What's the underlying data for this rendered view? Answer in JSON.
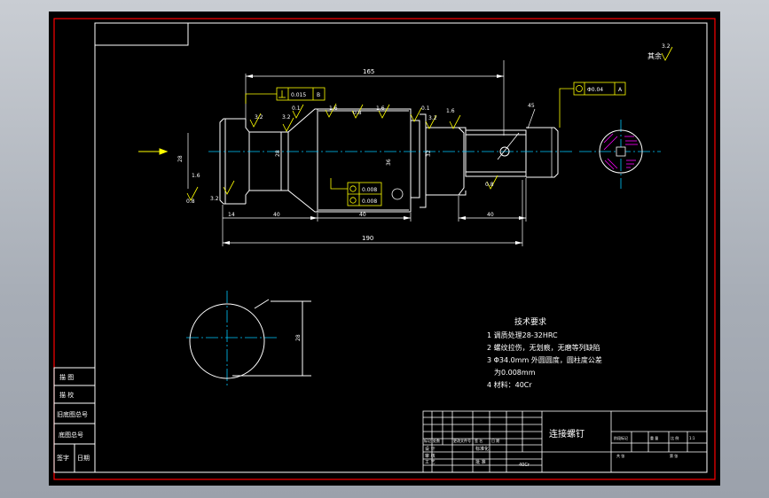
{
  "drawing": {
    "part_name": "连接螺钉",
    "dimensions": {
      "top_overall": "165",
      "bottom_overall": "190",
      "left_len": "14",
      "mid_len": "40",
      "section_len": "40",
      "right_len": "40",
      "left_dia": "28",
      "d1": "28",
      "d2": "36",
      "small_dia": "32",
      "sec_dia": "28"
    },
    "roughness": {
      "r1": "3.2",
      "r2": "3.2",
      "r3": "0.1",
      "r4": "1.6",
      "r5": "0.8",
      "r6": "1.6",
      "r7": "0.1",
      "r8": "3.2",
      "r9": "1.6",
      "r10": "1.6",
      "r11": "0.8",
      "r12": "3.2",
      "r13": "0.8",
      "others_label": "其余",
      "others_value": "3.2"
    },
    "tolerances": {
      "perp_value": "0.015",
      "perp_datum": "B",
      "conc_value": "Φ0.04",
      "conc_datum": "A",
      "cyl_value": "0.008",
      "round_value": "0.008",
      "chamfer": "45"
    },
    "notes": {
      "heading": "技术要求",
      "line1": "1  调质处理28-32HRC",
      "line2": "2  螺纹拉伤，无划痕，无磨等列缺陷",
      "line3": "3  Φ34.0mm  外圆圆度，圆柱度公差",
      "line4": "为0.008mm",
      "line5": "4  材料：40Cr"
    },
    "left_table": {
      "r1": "描  图",
      "r2": "描  校",
      "r3": "旧底图总号",
      "r4": "底图总号",
      "r5a": "签字",
      "r5b": "日期"
    },
    "title_block": {
      "scale": "1:1",
      "material_mark": "40Cr",
      "designer": "设 计",
      "checker": "审 核",
      "approver": "批 准",
      "std": "标准化",
      "process": "工 艺",
      "sign_a": "标记",
      "sign_b": "处数",
      "sign_c": "更改文件号",
      "sign_d": "签 名",
      "sign_e": "日 期",
      "cols_stage": "阶段标记",
      "cols_weight": "重 量",
      "cols_scale": "比 例",
      "cols_sheet": "共  张",
      "cols_page": "第  张"
    },
    "colors": {
      "border": "#ff0000",
      "geometry": "#ffffff",
      "dimension": "#ffffff",
      "centerline": "#00c8ff",
      "annotation": "#ffff00",
      "hatch": "#ff00ff"
    }
  }
}
